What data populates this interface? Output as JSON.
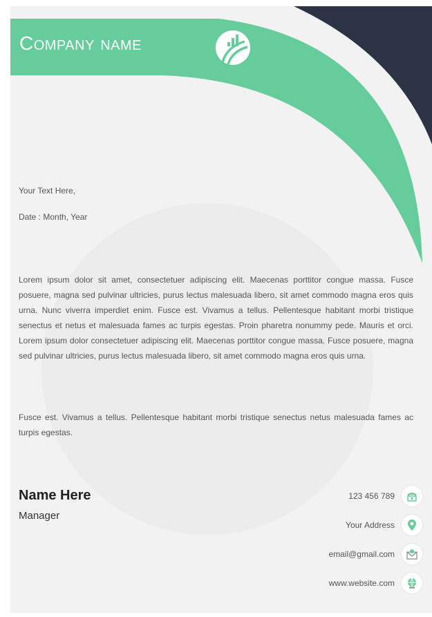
{
  "header": {
    "company_name": "Company name"
  },
  "letter": {
    "greeting": "Your Text Here,",
    "date": "Date : Month, Year",
    "paragraph_1": "Lorem ipsum dolor sit amet, consectetuer adipiscing elit. Maecenas porttitor congue massa. Fusce posuere, magna sed pulvinar ultricies, purus lectus malesuada libero, sit amet commodo magna eros quis urna. Nunc viverra imperdiet enim. Fusce est. Vivamus a tellus. Pellentesque habitant morbi tristique senectus et netus et malesuada fames ac turpis egestas. Proin pharetra nonummy pede. Mauris et orci. Lorem ipsum dolor consectetuer adipiscing elit. Maecenas porttitor congue massa. Fusce posuere, magna sed pulvinar ultricies, purus lectus malesuada libero, sit amet commodo magna eros quis urna.",
    "paragraph_2": "Fusce est. Vivamus a tellus. Pellentesque habitant morbi tristique senectus netus malesuada fames ac turpis egestas."
  },
  "signature": {
    "name": "Name Here",
    "title": "Manager"
  },
  "contact": {
    "phone": "123 456 789",
    "address": "Your Address",
    "email": "email@gmail.com",
    "website": "www.website.com"
  },
  "colors": {
    "accent_green": "#66cc9b",
    "navy": "#2b3344",
    "page_bg": "#f2f2f2"
  },
  "icons": [
    "logo-icon",
    "phone-icon",
    "location-pin-icon",
    "email-icon",
    "globe-icon"
  ]
}
